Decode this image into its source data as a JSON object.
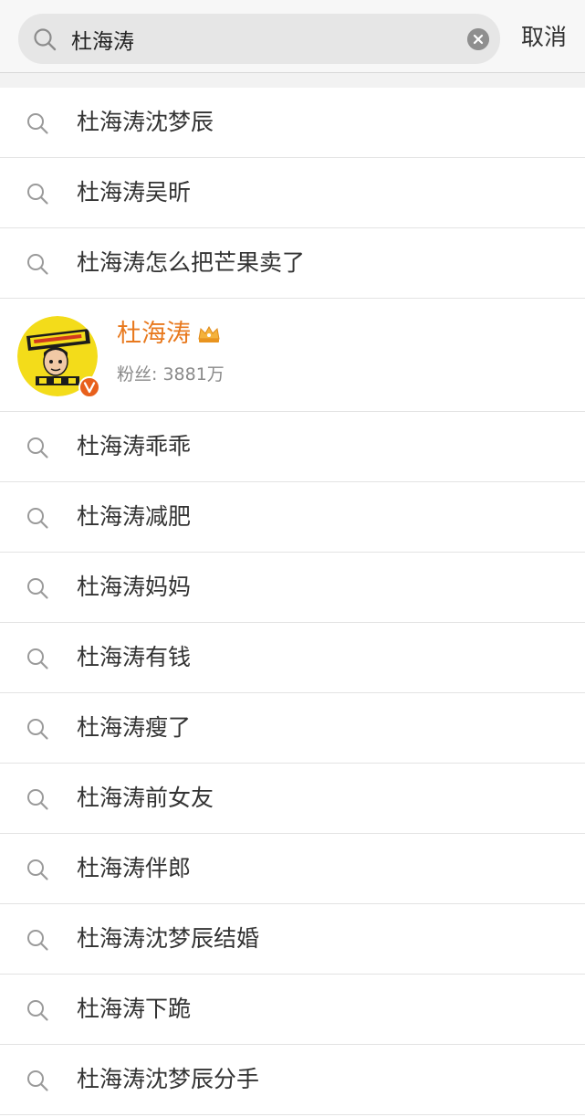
{
  "search": {
    "query": "杜海涛",
    "cancel_label": "取消"
  },
  "suggestions_top": [
    {
      "label": "杜海涛沈梦辰"
    },
    {
      "label": "杜海涛吴昕"
    },
    {
      "label": "杜海涛怎么把芒果卖了"
    }
  ],
  "user_card": {
    "name": "杜海涛",
    "followers": "粉丝: 3881万",
    "badge_icon": "verified-v-icon",
    "crown_icon": "crown-icon",
    "name_color": "#e8791e",
    "badge_color": "#e8601c"
  },
  "suggestions_bottom": [
    {
      "label": "杜海涛乖乖"
    },
    {
      "label": "杜海涛减肥"
    },
    {
      "label": "杜海涛妈妈"
    },
    {
      "label": "杜海涛有钱"
    },
    {
      "label": "杜海涛瘦了"
    },
    {
      "label": "杜海涛前女友"
    },
    {
      "label": "杜海涛伴郎"
    },
    {
      "label": "杜海涛沈梦辰结婚"
    },
    {
      "label": "杜海涛下跪"
    },
    {
      "label": "杜海涛沈梦辰分手"
    }
  ]
}
